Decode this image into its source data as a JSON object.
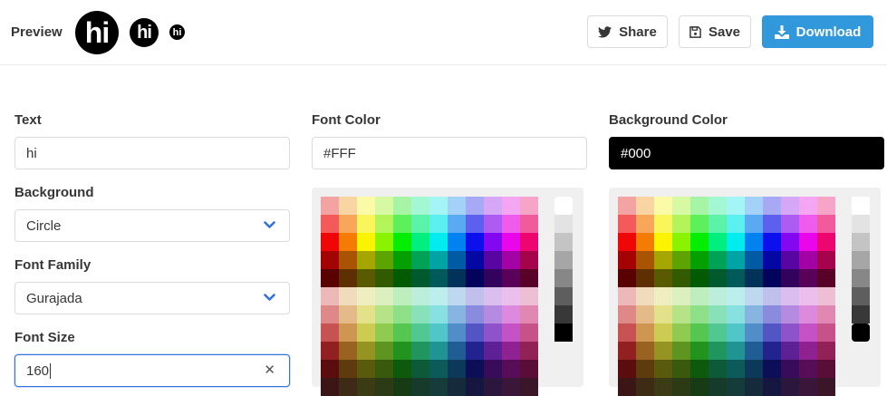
{
  "header": {
    "preview_label": "Preview",
    "avatar_text": "hi",
    "share_label": "Share",
    "save_label": "Save",
    "download_label": "Download",
    "download_color": "#3298dc"
  },
  "form": {
    "text_label": "Text",
    "text_value": "hi",
    "background_label": "Background",
    "background_value": "Circle",
    "font_family_label": "Font Family",
    "font_family_value": "Gurajada",
    "font_size_label": "Font Size",
    "font_size_value": "160",
    "font_color_label": "Font Color",
    "font_color_value": "#FFF",
    "background_color_label": "Background Color",
    "background_color_value": "#000"
  },
  "palette": {
    "hues": [
      [
        "#f4a3a3",
        "#f9d5a4",
        "#fbfaa6",
        "#d8f9a4",
        "#a6f5a4",
        "#a4f7d3",
        "#a4f6f6",
        "#a4d1f7",
        "#a8a9f5",
        "#d6a7f7",
        "#f4a6f3",
        "#f6a4c8"
      ],
      [
        "#f35a59",
        "#f8a65a",
        "#f9f55b",
        "#b2f45a",
        "#5ef05a",
        "#5af3a8",
        "#5af0f0",
        "#5aa9f3",
        "#5d60ef",
        "#ad5cf3",
        "#ef5ced",
        "#f15a9b"
      ],
      [
        "#ef0707",
        "#f57c04",
        "#fbf400",
        "#8af300",
        "#05ee00",
        "#00ef7e",
        "#00ecef",
        "#0082f0",
        "#0b10ec",
        "#8308f1",
        "#ea06eb",
        "#ed0670"
      ],
      [
        "#a40303",
        "#a95402",
        "#a6a600",
        "#5ea401",
        "#03a000",
        "#00a255",
        "#00a4a4",
        "#005aa4",
        "#0507a3",
        "#5905a4",
        "#a303a4",
        "#a6034d"
      ],
      [
        "#5a0202",
        "#5e3001",
        "#5a5a00",
        "#325a00",
        "#025a01",
        "#005a2e",
        "#005a5a",
        "#00325a",
        "#02035b",
        "#32025c",
        "#5a025a",
        "#5a012a"
      ],
      [
        "#ecb9b8",
        "#f0dcbc",
        "#efeec0",
        "#dcefbe",
        "#beeebd",
        "#bdeedb",
        "#bdeeee",
        "#bed8ef",
        "#c0c0ec",
        "#dabeef",
        "#ecbeec",
        "#eebed4"
      ],
      [
        "#df8888",
        "#e4bb88",
        "#e3e28b",
        "#b7e388",
        "#8de088",
        "#88e1b8",
        "#88e0e1",
        "#88b4e1",
        "#8b8bde",
        "#b58be2",
        "#dd89dd",
        "#e088b1"
      ],
      [
        "#c65252",
        "#ce9651",
        "#cccb52",
        "#8fcb50",
        "#55c751",
        "#51c891",
        "#51c6c8",
        "#518ec9",
        "#5455c4",
        "#8e52ca",
        "#c452c4",
        "#c65289"
      ],
      [
        "#932020",
        "#9a6221",
        "#959422",
        "#5e9520",
        "#239320",
        "#20955e",
        "#209393",
        "#205d95",
        "#22238f",
        "#5d2095",
        "#902190",
        "#922158"
      ],
      [
        "#5b0d0d",
        "#5d3b0c",
        "#5a5a0d",
        "#395a0c",
        "#0e5a0c",
        "#0d5a39",
        "#0d5a5a",
        "#0c385a",
        "#0d0e58",
        "#380c5b",
        "#580d58",
        "#5a0d36"
      ],
      [
        "#3c1616",
        "#3e2b15",
        "#3b3b16",
        "#2c3b15",
        "#173b15",
        "#163b2b",
        "#163b3b",
        "#152b3b",
        "#161740",
        "#2b163d",
        "#3b163b",
        "#3b1629"
      ]
    ],
    "grays": [
      "#ffffff",
      "#e3e3e3",
      "#c4c4c4",
      "#a6a6a6",
      "#878787",
      "#5e5e5e",
      "#383838",
      "#000000"
    ]
  }
}
